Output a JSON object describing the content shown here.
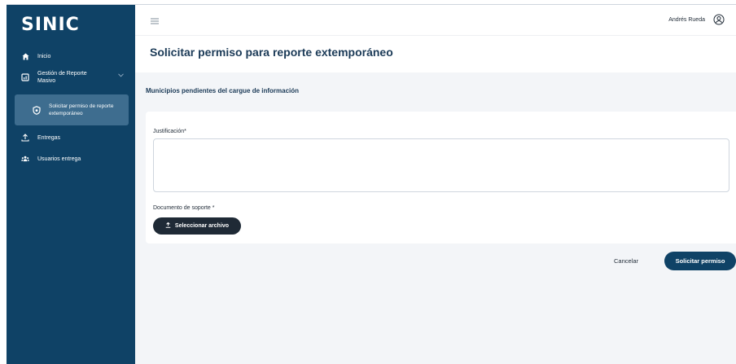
{
  "brand": {
    "logo": "SINIC"
  },
  "sidebar": {
    "items": [
      {
        "label": "Inicio",
        "icon": "home-icon"
      },
      {
        "label": "Gestión de Reporte Masivo",
        "icon": "report-icon"
      },
      {
        "label": "Entregas",
        "icon": "upload-icon"
      },
      {
        "label": "Usuarios entrega",
        "icon": "users-icon"
      }
    ],
    "subitem": {
      "label": "Solicitar permiso de reporte extemporáneo",
      "icon": "shield-icon"
    }
  },
  "topbar": {
    "user_name": "Andrés Rueda"
  },
  "page": {
    "title": "Solicitar permiso para reporte extemporáneo"
  },
  "section": {
    "title": "Municipios pendientes del cargue de información"
  },
  "form": {
    "justification_label": "Justificación*",
    "justification_value": "",
    "document_label": "Documento de soporte *",
    "file_button_label": "Seleccionar archivo"
  },
  "actions": {
    "cancel_label": "Cancelar",
    "submit_label": "Solicitar permiso"
  },
  "colors": {
    "sidebar_bg": "#0f4266",
    "sidebar_active": "#3e6d8f",
    "primary_button": "#0f4266",
    "dark_button": "#1f2a36",
    "content_bg": "#f3f5f8"
  }
}
